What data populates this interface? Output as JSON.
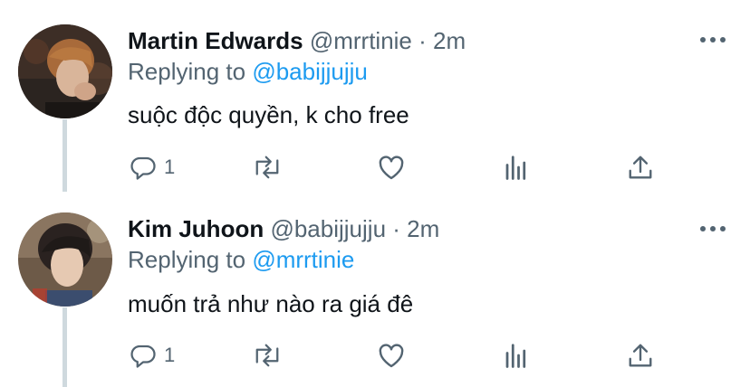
{
  "tweets": [
    {
      "name": "Martin Edwards",
      "handle": "@mrrtinie",
      "separator": "·",
      "time": "2m",
      "replying_prefix": "Replying to",
      "replying_to": "@babijjujju",
      "text": "suộc độc quyền, k cho free",
      "reply_count": "1",
      "avatar": "avatar-martin",
      "icons": [
        "reply-icon",
        "retweet-icon",
        "like-icon",
        "analytics-icon",
        "share-icon",
        "more-icon"
      ]
    },
    {
      "name": "Kim Juhoon",
      "handle": "@babijjujju",
      "separator": "·",
      "time": "2m",
      "replying_prefix": "Replying to",
      "replying_to": "@mrrtinie",
      "text": "muốn trả như nào ra giá đê",
      "reply_count": "1",
      "avatar": "avatar-kim",
      "icons": [
        "reply-icon",
        "retweet-icon",
        "like-icon",
        "analytics-icon",
        "share-icon",
        "more-icon"
      ]
    }
  ],
  "colors": {
    "text": "#0f1419",
    "secondary": "#536471",
    "link": "#1d9bf0",
    "thread_line": "#cfd9de",
    "icon": "#536471"
  }
}
